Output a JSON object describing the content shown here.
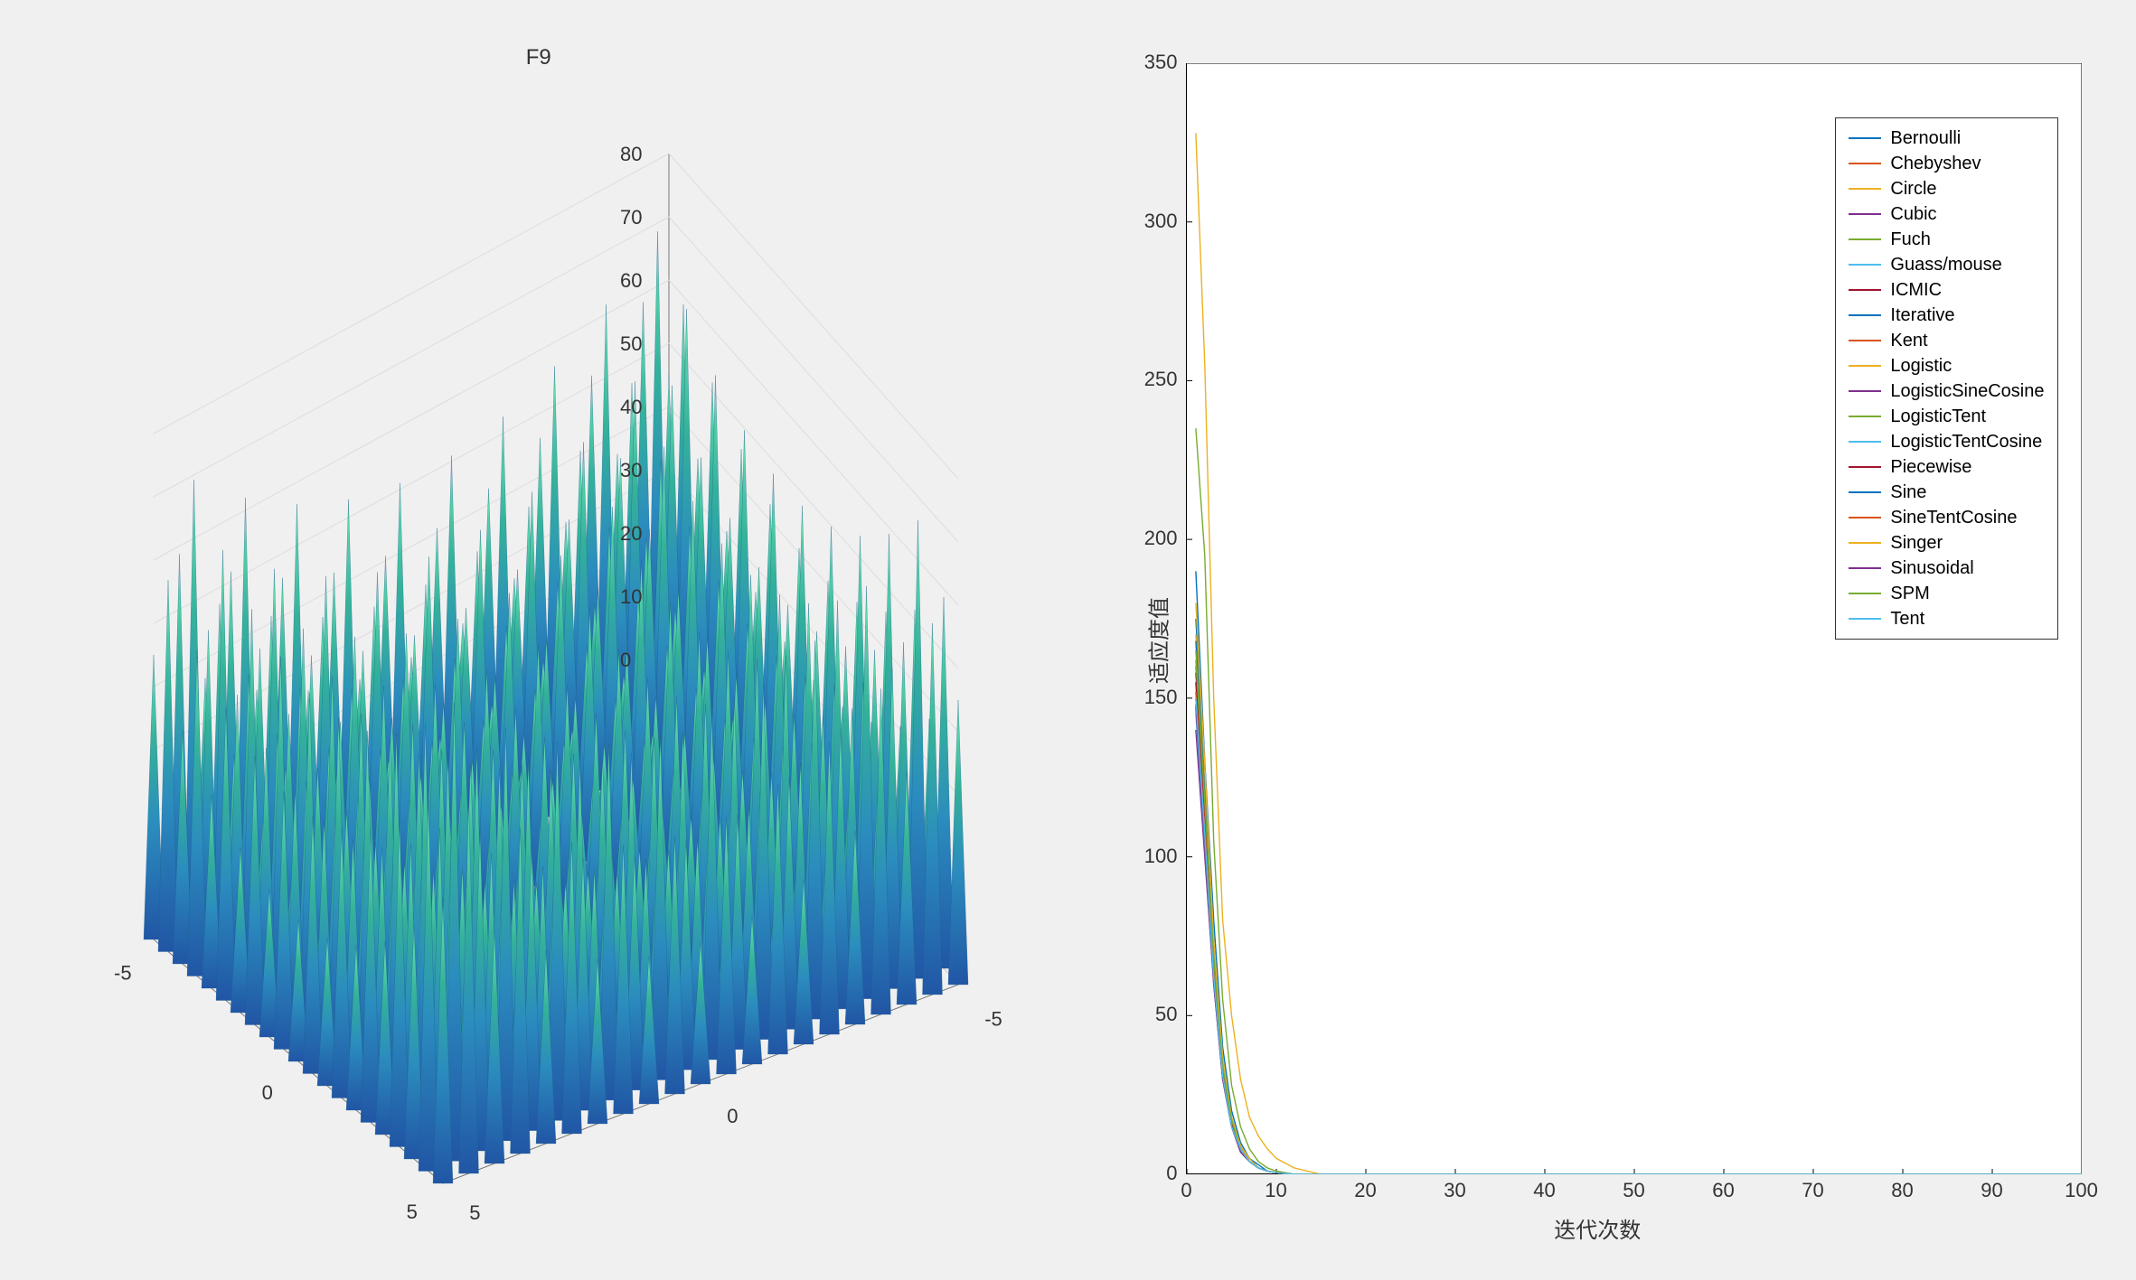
{
  "chart_data": [
    {
      "type": "surface3d",
      "title": "F9",
      "x_range": [
        -5,
        5
      ],
      "y_range": [
        -5,
        5
      ],
      "z_range": [
        0,
        80
      ],
      "x_ticks": [
        -5,
        0,
        5
      ],
      "y_ticks": [
        -5,
        0,
        5
      ],
      "z_ticks": [
        0,
        10,
        20,
        30,
        40,
        50,
        60,
        70,
        80
      ],
      "function": "Rastrigin-like multimodal benchmark function",
      "colormap": "parula-blue-green",
      "contour_on_floor": true
    },
    {
      "type": "line",
      "title": "",
      "xlabel": "迭代次数",
      "ylabel": "适应度值",
      "xlim": [
        0,
        100
      ],
      "ylim": [
        0,
        350
      ],
      "x_ticks": [
        0,
        10,
        20,
        30,
        40,
        50,
        60,
        70,
        80,
        90,
        100
      ],
      "y_ticks": [
        0,
        50,
        100,
        150,
        200,
        250,
        300,
        350
      ],
      "x": [
        1,
        2,
        3,
        4,
        5,
        6,
        7,
        8,
        9,
        10,
        12,
        15,
        100
      ],
      "series": [
        {
          "name": "Bernoulli",
          "color": "#0072BD",
          "values": [
            190,
            130,
            80,
            40,
            20,
            10,
            5,
            3,
            1,
            0.5,
            0,
            0,
            0
          ]
        },
        {
          "name": "Chebyshev",
          "color": "#D95319",
          "values": [
            160,
            120,
            70,
            30,
            15,
            8,
            4,
            2,
            1,
            0.5,
            0,
            0,
            0
          ]
        },
        {
          "name": "Circle",
          "color": "#EDB120",
          "values": [
            328,
            255,
            150,
            80,
            50,
            30,
            18,
            12,
            8,
            5,
            2,
            0,
            0
          ]
        },
        {
          "name": "Cubic",
          "color": "#7E2F8E",
          "values": [
            140,
            100,
            60,
            30,
            15,
            8,
            4,
            2,
            1,
            0.5,
            0,
            0,
            0
          ]
        },
        {
          "name": "Fuch",
          "color": "#77AC30",
          "values": [
            235,
            195,
            105,
            55,
            28,
            15,
            8,
            4,
            2,
            1,
            0,
            0,
            0
          ]
        },
        {
          "name": "Guass/mouse",
          "color": "#4DBEEE",
          "values": [
            155,
            110,
            65,
            32,
            16,
            8,
            4,
            2,
            1,
            0.5,
            0,
            0,
            0
          ]
        },
        {
          "name": "ICMIC",
          "color": "#A2142F",
          "values": [
            158,
            115,
            68,
            34,
            17,
            9,
            4,
            2,
            1,
            0.5,
            0,
            0,
            0
          ]
        },
        {
          "name": "Iterative",
          "color": "#0072BD",
          "values": [
            175,
            125,
            72,
            36,
            18,
            9,
            5,
            2,
            1,
            0.5,
            0,
            0,
            0
          ]
        },
        {
          "name": "Kent",
          "color": "#D95319",
          "values": [
            150,
            108,
            62,
            31,
            15,
            8,
            4,
            2,
            1,
            0.5,
            0,
            0,
            0
          ]
        },
        {
          "name": "Logistic",
          "color": "#EDB120",
          "values": [
            170,
            122,
            70,
            35,
            17,
            9,
            4,
            2,
            1,
            0.5,
            0,
            0,
            0
          ]
        },
        {
          "name": "LogisticSineCosine",
          "color": "#7E2F8E",
          "values": [
            148,
            106,
            61,
            30,
            15,
            7,
            4,
            2,
            1,
            0.5,
            0,
            0,
            0
          ]
        },
        {
          "name": "LogisticTent",
          "color": "#77AC30",
          "values": [
            162,
            116,
            67,
            33,
            16,
            8,
            4,
            2,
            1,
            0.5,
            0,
            0,
            0
          ]
        },
        {
          "name": "LogisticTentCosine",
          "color": "#4DBEEE",
          "values": [
            145,
            104,
            60,
            30,
            15,
            7,
            4,
            2,
            1,
            0.5,
            0,
            0,
            0
          ]
        },
        {
          "name": "Piecewise",
          "color": "#A2142F",
          "values": [
            155,
            111,
            64,
            32,
            16,
            8,
            4,
            2,
            1,
            0.5,
            0,
            0,
            0
          ]
        },
        {
          "name": "Sine",
          "color": "#0072BD",
          "values": [
            168,
            120,
            69,
            34,
            17,
            8,
            4,
            2,
            1,
            0.5,
            0,
            0,
            0
          ]
        },
        {
          "name": "SineTentCosine",
          "color": "#D95319",
          "values": [
            152,
            109,
            63,
            31,
            15,
            8,
            4,
            2,
            1,
            0.5,
            0,
            0,
            0
          ]
        },
        {
          "name": "Singer",
          "color": "#EDB120",
          "values": [
            180,
            129,
            74,
            37,
            18,
            9,
            5,
            2,
            1,
            0.5,
            0,
            0,
            0
          ]
        },
        {
          "name": "Sinusoidal",
          "color": "#7E2F8E",
          "values": [
            147,
            105,
            60,
            30,
            15,
            7,
            4,
            2,
            1,
            0.5,
            0,
            0,
            0
          ]
        },
        {
          "name": "SPM",
          "color": "#77AC30",
          "values": [
            165,
            118,
            68,
            34,
            17,
            8,
            4,
            2,
            1,
            0.5,
            0,
            0,
            0
          ]
        },
        {
          "name": "Tent",
          "color": "#4DBEEE",
          "values": [
            150,
            107,
            62,
            31,
            15,
            8,
            4,
            2,
            1,
            0.5,
            0,
            0,
            0
          ]
        }
      ],
      "legend_position": "northeast"
    }
  ]
}
